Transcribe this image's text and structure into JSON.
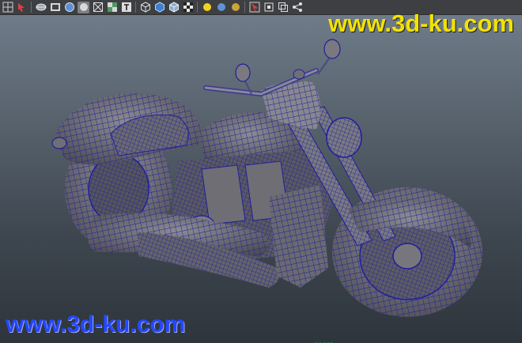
{
  "toolbar": {
    "buttons": [
      {
        "icon": "grid-icon"
      },
      {
        "icon": "select-arrow-icon"
      },
      {
        "icon": "shaded-wireframe-icon"
      },
      {
        "icon": "film-icon"
      },
      {
        "icon": "sphere-shaded-icon"
      },
      {
        "icon": "smooth-shade-icon"
      },
      {
        "icon": "wireframe-box-icon"
      },
      {
        "icon": "texture-icon"
      },
      {
        "icon": "text-icon"
      },
      {
        "icon": "cube-outline-icon"
      },
      {
        "icon": "cube-blue-icon"
      },
      {
        "icon": "cube-wire-icon"
      },
      {
        "icon": "checker-icon"
      },
      {
        "icon": "light-yellow-icon"
      },
      {
        "icon": "light-blue-icon"
      },
      {
        "icon": "light-gold-icon"
      },
      {
        "icon": "move-tool-icon"
      },
      {
        "icon": "isolate-icon"
      },
      {
        "icon": "xray-icon"
      },
      {
        "icon": "share-icon"
      }
    ]
  },
  "watermark": {
    "top_text": "www.3d-ku.com",
    "bottom_text": "www.3d-ku.com",
    "top_color": "#f2e200",
    "bottom_color": "#2448ff"
  },
  "viewport": {
    "camera_label": "persp",
    "wire_color": "#1d1d9a",
    "model_fill": "#6d6c72"
  }
}
